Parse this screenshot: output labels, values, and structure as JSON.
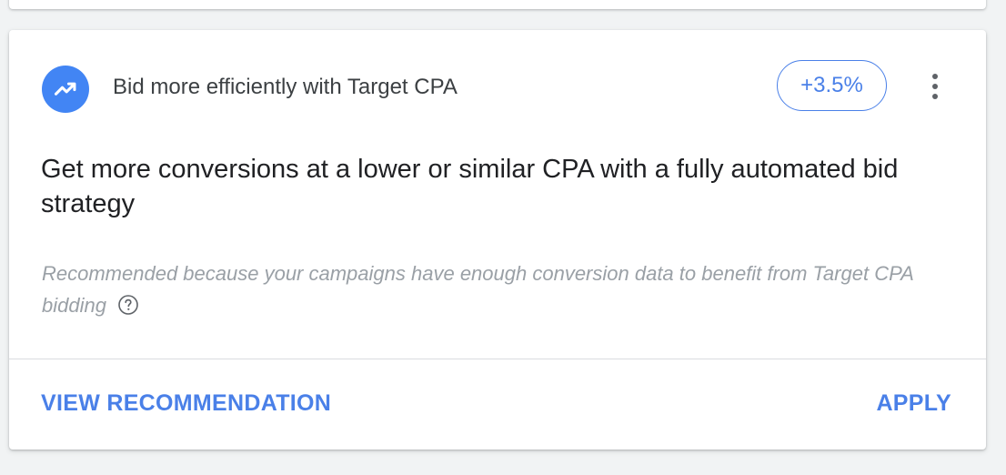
{
  "recommendation": {
    "category_icon": "trending-up-icon",
    "title": "Bid more efficiently with Target CPA",
    "score_badge": "+3.5%",
    "headline": "Get more conversions at a lower or similar CPA with a fully automated bid strategy",
    "reason": "Recommended because your campaigns have enough conversion data to benefit from Target CPA bidding",
    "help_icon": "help-circle-icon",
    "menu_icon": "more-vert-icon",
    "actions": {
      "view": "VIEW RECOMMENDATION",
      "apply": "APPLY"
    }
  },
  "colors": {
    "accent": "#4a80e8",
    "icon_bg": "#4285f4",
    "headline_text": "#202124",
    "muted_text": "#9aa0a6",
    "background": "#f1f3f4"
  }
}
